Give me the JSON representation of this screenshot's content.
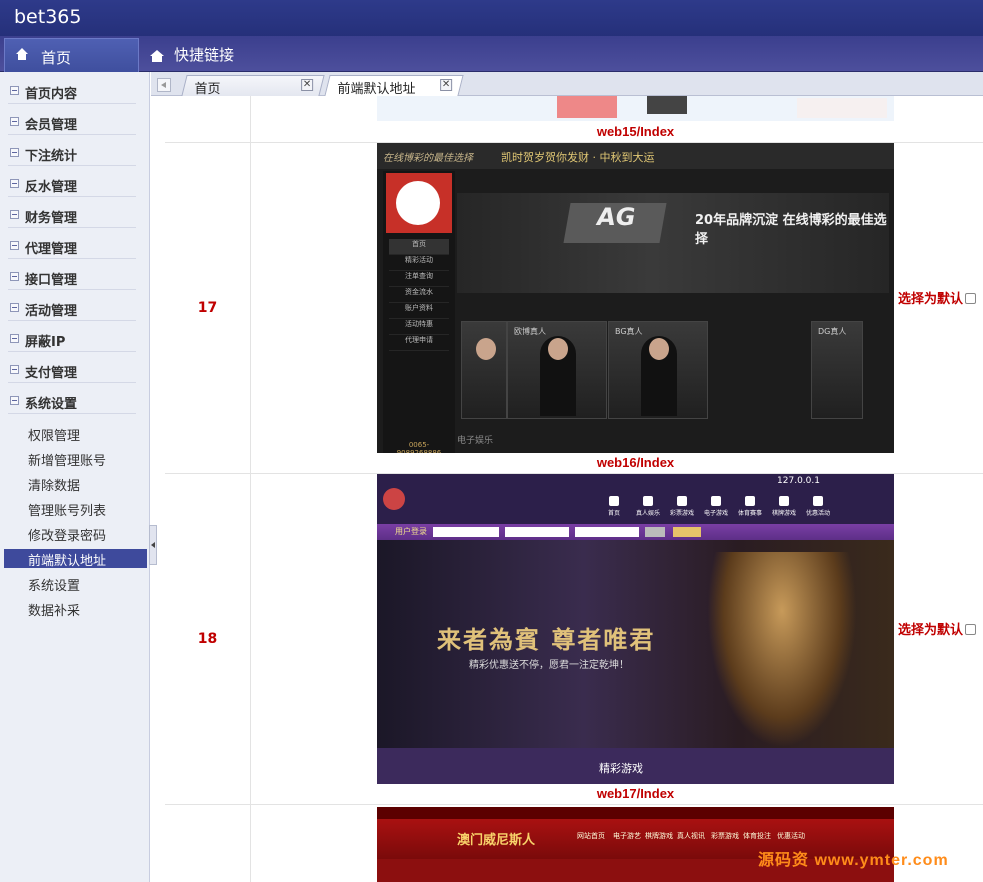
{
  "app": {
    "title": "bet365"
  },
  "navbar": {
    "home_tab": "首页",
    "quick_links": "快捷链接"
  },
  "sidebar": {
    "menus": [
      "首页内容",
      "会员管理",
      "下注统计",
      "反水管理",
      "财务管理",
      "代理管理",
      "接口管理",
      "活动管理",
      "屏蔽IP",
      "支付管理",
      "系统设置"
    ],
    "submenu": [
      "权限管理",
      "新增管理账号",
      "清除数据",
      "管理账号列表",
      "修改登录密码",
      "前端默认地址",
      "系统设置",
      "数据补采"
    ],
    "active_submenu": "前端默认地址"
  },
  "tabs": [
    {
      "label": "首页",
      "active": false
    },
    {
      "label": "前端默认地址",
      "active": true
    }
  ],
  "rows": [
    {
      "id": "",
      "label": "web15/Index",
      "choose": ""
    },
    {
      "id": "17",
      "label": "web16/Index",
      "choose": "选择为默认"
    },
    {
      "id": "18",
      "label": "web17/Index",
      "choose": "选择为默认"
    }
  ],
  "shot16": {
    "top_text": "在线博彩的最佳选择",
    "top_text2": "凯时贺岁贺你发财 · 中秋到大运",
    "nav": [
      "首页",
      "精彩活动",
      "注单查询",
      "资金流水",
      "账户资料",
      "活动特惠",
      "代理申请"
    ],
    "slogan": "20年品牌沉淀 在线博彩的最佳选择",
    "cards": [
      "欧博真人",
      "BG真人",
      "DG真人"
    ],
    "bottom": "电子娱乐",
    "phone": "0065-9089268886"
  },
  "shot17": {
    "ip": "127.0.0.1",
    "nav": [
      "首页",
      "真人娱乐",
      "彩票游戏",
      "电子游戏",
      "体育赛事",
      "棋牌游戏",
      "优惠活动"
    ],
    "login_label": "用户登录",
    "headline": "来者為賓 尊者唯君",
    "sub": "精彩优惠送不停，愿君一注定乾坤！",
    "footer": "精彩游戏"
  },
  "shot18": {
    "logo": "澳门威尼斯人",
    "menu": [
      "网站首页",
      "电子游艺",
      "棋牌游戏",
      "真人视讯",
      "彩票游戏",
      "体育投注",
      "优惠活动"
    ]
  },
  "watermark": "源码资 www.ymter.com"
}
